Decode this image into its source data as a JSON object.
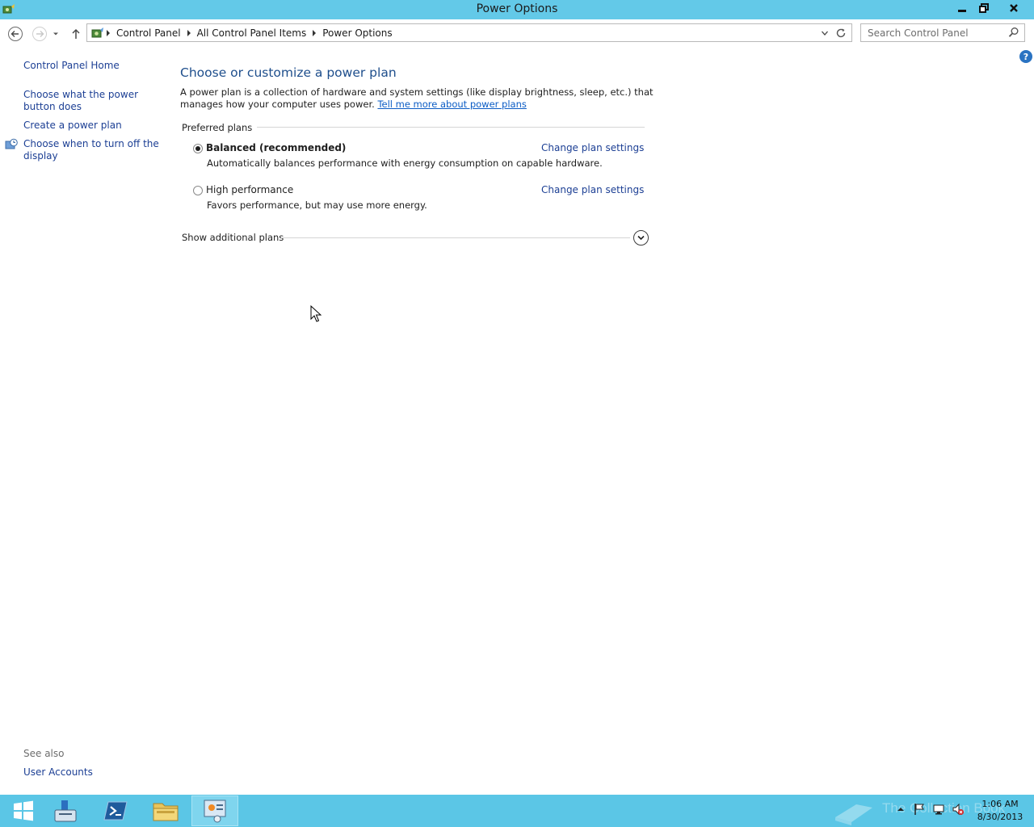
{
  "window": {
    "title": "Power Options",
    "icons": {
      "app": "power-options-icon",
      "minimize": "minimize-icon",
      "maximize": "restore-icon",
      "close": "close-icon"
    }
  },
  "navigation": {
    "breadcrumbs": [
      "Control Panel",
      "All Control Panel Items",
      "Power Options"
    ],
    "search_placeholder": "Search Control Panel"
  },
  "sidebar": {
    "home": "Control Panel Home",
    "links": [
      "Choose what the power button does",
      "Create a power plan",
      "Choose when to turn off the display"
    ],
    "see_also_label": "See also",
    "see_also_links": [
      "User Accounts"
    ]
  },
  "main": {
    "title": "Choose or customize a power plan",
    "intro": "A power plan is a collection of hardware and system settings (like display brightness, sleep, etc.) that manages how your computer uses power. ",
    "intro_link": "Tell me more about power plans",
    "preferred_label": "Preferred plans",
    "plans": [
      {
        "name": "Balanced (recommended)",
        "description": "Automatically balances performance with energy consumption on capable hardware.",
        "link": "Change plan settings",
        "selected": true
      },
      {
        "name": "High performance",
        "description": "Favors performance, but may use more energy.",
        "link": "Change plan settings",
        "selected": false
      }
    ],
    "show_additional": "Show additional plans"
  },
  "taskbar": {
    "items": [
      "start-icon",
      "server-manager-icon",
      "powershell-icon",
      "file-explorer-icon",
      "control-panel-icon"
    ],
    "active_item": "control-panel-icon",
    "time": "1:06 AM",
    "date": "8/30/2013",
    "watermark": "The Collection Book"
  },
  "colors": {
    "titlebar": "#63c9e8",
    "taskbar": "#5bc6e6",
    "link": "#1c3f94",
    "heading": "#1e4e8c"
  }
}
